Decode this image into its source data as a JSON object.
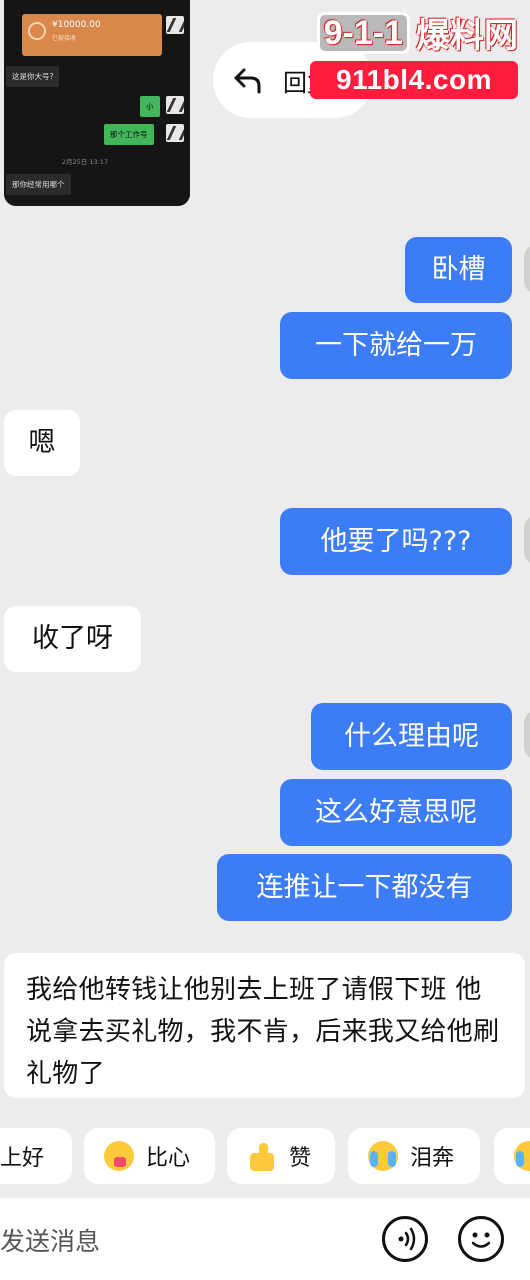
{
  "embedded_screenshot": {
    "transfer_amount": "¥10000.00",
    "transfer_status": "已被接收",
    "messages": [
      {
        "side": "in",
        "text": "这是你大号?"
      },
      {
        "side": "out",
        "text": "小"
      },
      {
        "side": "out",
        "text": "那个工作号"
      },
      {
        "side": "in",
        "text": "那你经常用哪个"
      }
    ],
    "date": "2月25日 13:17"
  },
  "reply_action": {
    "icon": "reply-arrow-icon",
    "label": "回复"
  },
  "watermark": {
    "badge": "9-1-1",
    "text": "爆料网",
    "url": "911bl4.com"
  },
  "messages": [
    {
      "side": "out",
      "text": "卧槽"
    },
    {
      "side": "out",
      "text": "一下就给一万"
    },
    {
      "side": "in",
      "text": "嗯"
    },
    {
      "side": "out",
      "text": "他要了吗???"
    },
    {
      "side": "in",
      "text": "收了呀"
    },
    {
      "side": "out",
      "text": "什么理由呢"
    },
    {
      "side": "out",
      "text": "这么好意思呢"
    },
    {
      "side": "out",
      "text": "连推让一下都没有"
    },
    {
      "side": "in",
      "text": "我给他转钱让他别去上班了请假下班 他说拿去买礼物，我不肯，后来我又给他刷礼物了"
    }
  ],
  "quick_replies": [
    {
      "label": "上好",
      "icon": ""
    },
    {
      "label": "比心",
      "icon": "heart-hands-icon"
    },
    {
      "label": "赞",
      "icon": "thumbs-up-icon"
    },
    {
      "label": "泪奔",
      "icon": "crying-face-icon"
    },
    {
      "label": "",
      "icon": "crying-face-icon"
    }
  ],
  "composer": {
    "placeholder": "发送消息",
    "voice_icon": "voice-icon",
    "emoji_icon": "emoji-icon"
  },
  "colors": {
    "outgoing_bubble": "#3c7cf5",
    "incoming_bubble": "#ffffff",
    "background": "#ececee"
  }
}
